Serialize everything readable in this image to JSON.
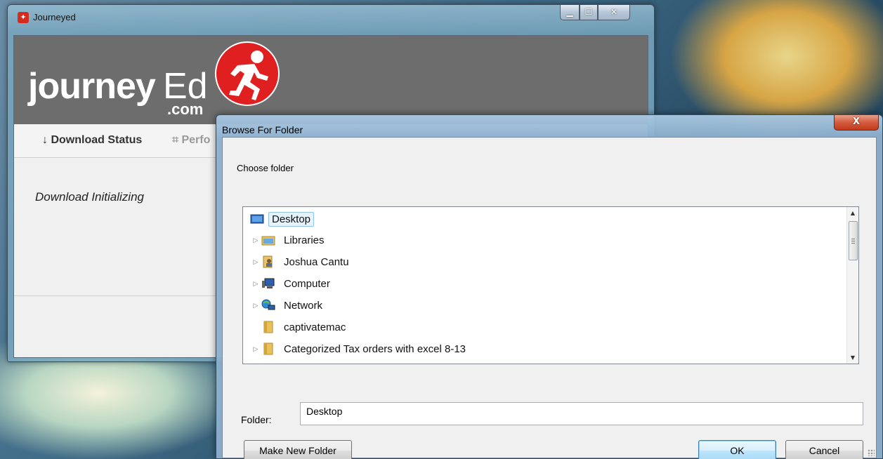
{
  "main_window": {
    "title": "Journeyed",
    "controls": {
      "minimize": "▁",
      "maximize": "☐",
      "close": "✕"
    },
    "banner": {
      "logo_journey": "journey",
      "logo_ed": "Ed",
      "logo_com": ".com",
      "logo_color": "#e02020"
    },
    "tabs": [
      {
        "label": "Download Status",
        "icon": "download-arrow-icon",
        "active": true
      },
      {
        "label": "Perfo",
        "icon": "chart-icon",
        "active": false
      }
    ],
    "status_text": "Download Initializing"
  },
  "dialog": {
    "title": "Browse For Folder",
    "close_glyph": "X",
    "prompt": "Choose folder",
    "tree_items": [
      {
        "label": "Desktop",
        "icon": "desktop-icon",
        "expandable": false,
        "selected": true
      },
      {
        "label": "Libraries",
        "icon": "libraries-icon",
        "expandable": true
      },
      {
        "label": "Joshua Cantu",
        "icon": "user-folder-icon",
        "expandable": true
      },
      {
        "label": "Computer",
        "icon": "computer-icon",
        "expandable": true
      },
      {
        "label": "Network",
        "icon": "network-icon",
        "expandable": true
      },
      {
        "label": "captivatemac",
        "icon": "folder-icon",
        "expandable": false
      },
      {
        "label": "Categorized Tax orders  with  excel 8-13",
        "icon": "folder-icon",
        "expandable": true
      }
    ],
    "folder_label": "Folder:",
    "folder_value": "Desktop",
    "buttons": {
      "make_new_folder": "Make New Folder",
      "ok": "OK",
      "cancel": "Cancel"
    }
  }
}
